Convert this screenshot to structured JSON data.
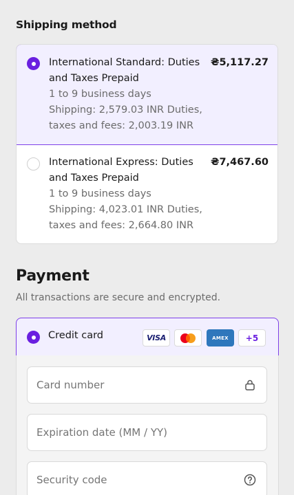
{
  "shipping": {
    "title": "Shipping method",
    "options": [
      {
        "name": "International Standard: Duties and Taxes Prepaid",
        "name_line1": "International Standard: Duties",
        "name_line2": "and Taxes Prepaid",
        "delivery": "1 to 9 business days",
        "fees_line1": "Shipping: 2,579.03 INR Duties,",
        "fees_line2": "taxes and fees: 2,003.19 INR",
        "price": "₴5,117.27",
        "selected": true
      },
      {
        "name": "International Express: Duties and Taxes Prepaid",
        "name_line1": "International Express: Duties",
        "name_line2": "and Taxes Prepaid",
        "delivery": "1 to 9 business days",
        "fees_line1": "Shipping: 4,023.01 INR Duties,",
        "fees_line2": "taxes and fees: 2,664.80 INR",
        "price": "₴7,467.60",
        "selected": false
      }
    ]
  },
  "payment": {
    "title": "Payment",
    "subtitle": "All transactions are secure and encrypted.",
    "method": {
      "label": "Credit card",
      "selected": true,
      "card_brands": [
        "VISA",
        "Mastercard",
        "AMEX"
      ],
      "visa_label": "VISA",
      "amex_label": "AMEX",
      "more_label": "+5"
    },
    "fields": {
      "card_number": {
        "placeholder": "Card number",
        "value": ""
      },
      "expiration": {
        "placeholder": "Expiration date (MM / YY)",
        "value": ""
      },
      "security_code": {
        "placeholder": "Security code",
        "value": ""
      }
    }
  },
  "colors": {
    "accent": "#6a1fe0",
    "selected_bg": "#f2efff",
    "page_bg": "#ececec"
  },
  "icons": {
    "card_number": "lock-icon",
    "security_code": "help-circle-icon"
  }
}
